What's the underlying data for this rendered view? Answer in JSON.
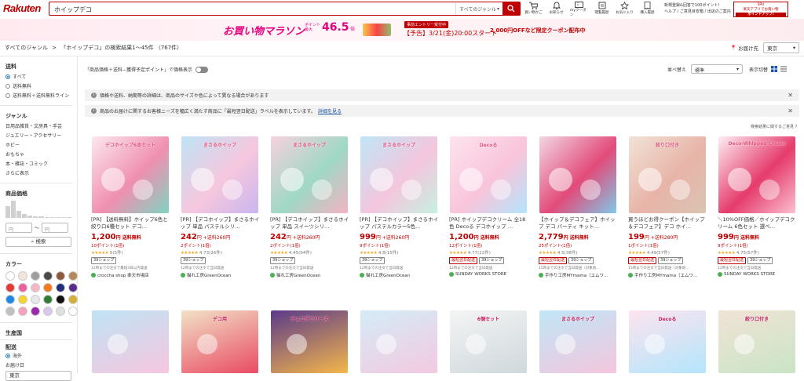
{
  "header": {
    "logo": "Rakuten",
    "search_value": "ホイップデコ",
    "genre_select": "すべてのジャンル",
    "icons": [
      {
        "label": "買い物かご",
        "icon": "cart-icon"
      },
      {
        "label": "お知らせ",
        "icon": "bell-icon"
      },
      {
        "label": "myクーポン",
        "icon": "coupon-icon"
      },
      {
        "label": "閲覧履歴",
        "icon": "history-icon"
      },
      {
        "label": "お気に入り",
        "icon": "star-icon"
      },
      {
        "label": "購入履歴",
        "icon": "receipt-icon"
      }
    ],
    "links_line1": "新規登録&回答で100ポイント!",
    "links_line2": "ヘルプ / ご意見目安箱 / 出店のご案内",
    "side_banner_top": "SPU",
    "side_banner_mid": "楽天アプリでお買い物",
    "side_banner_bottom": "ポイントアップ!"
  },
  "promo": {
    "title": "お買い物マラソン",
    "points_label": "ポイント最大",
    "points_value": "46.5",
    "points_suffix": "倍",
    "entry_label": "事前エントリー受付中",
    "date_text": "【予告】3/21(金)20:00スタート",
    "coupon_text": "2,000円OFFなど限定クーポン配布中"
  },
  "breadcrumb": {
    "root": "すべてのジャンル",
    "sep": ">",
    "current": "「ホイップデコ」の検索結果1～45件 （767件）"
  },
  "shipping": {
    "label": "お届け先",
    "value": "東京"
  },
  "sidebar": {
    "shipping_title": "送料",
    "shipping_options": [
      "すべて",
      "送料無料",
      "送料無料＋送料無料ライン"
    ],
    "genre_title": "ジャンル",
    "genres": [
      "日用品雑貨・文房具・手芸",
      "ジュエリー・アクセサリー",
      "ホビー",
      "おもちゃ",
      "本・雑誌・コミック",
      "さらに表示"
    ],
    "price_title": "商品価格",
    "price_min": "円",
    "price_tilde": "～",
    "price_max": "円",
    "price_button": "検索",
    "color_title": "カラー",
    "colors": [
      "#ffffff",
      "#f2e6d8",
      "#9e9e9e",
      "#4a4a4a",
      "#8a5a3c",
      "#b5895b",
      "#e53935",
      "#ec5f9b",
      "#f4b7c7",
      "#f07a1c",
      "#1f2d7a",
      "#5a2b8c",
      "#1e88e5",
      "#f6d32d",
      "#e8e8e8",
      "#2e7d32",
      "#111111",
      "#d4af37",
      "#c0c0c0",
      "#f6a0c0",
      "#9c27b0",
      "#d9c7f0",
      "#e0e0e0",
      "#ffffff"
    ],
    "origin_title": "生産国",
    "delivery_title": "配送",
    "delivery_option": "海外",
    "delivery_date_title": "お届け日",
    "delivery_place": "東京"
  },
  "main": {
    "price_toggle_label": "「商品価格＋送料−獲得予定ポイント」で価格表示",
    "sort_label": "並べ替え",
    "sort_value": "標準",
    "view_label": "表示切替",
    "notice1": "価格や送料、納期等の詳細は、商品のサイズや色によって異なる場合があります",
    "notice2": "商品のお届けに関するお客様ニーズを幅広く満たす商品に「最短翌日配送」ラベルを表示しています。",
    "notice2_link": "詳細を見る",
    "feedback": "検索結果に関するご意見"
  },
  "products": [
    {
      "title": "[PR] 【送料無料】ホイップ6色と絞り口6種セット デコ…",
      "price": "1,200",
      "ship": "円 送料無料",
      "points": "10ポイント(1倍)",
      "stars": "★★★★★",
      "rating": "5",
      "reviews": "(5件)",
      "tags": [
        "39ショップ"
      ],
      "delivery": "12時までの注文で最短3日以内発送",
      "shop": "croccha shop 楽天市場店",
      "img_text": "デコホイップ6本セット",
      "colors": [
        "#fbe9ee",
        "#f08fb0",
        "#7fd4c1"
      ]
    },
    {
      "title": "[PR] 【デコホイップ】まさるホイップ 単品 パステルシリ…",
      "price": "242",
      "ship": "円 +送料260円",
      "points": "2ポイント(1倍)",
      "stars": "★★★★★",
      "rating": "4.73",
      "reviews": "(26件)",
      "tags": [
        "39ショップ"
      ],
      "delivery": "12時までの注文で当日発送",
      "shop": "猫れ工房GreenOcean",
      "img_text": "まさるホイップ",
      "colors": [
        "#bfe3f5",
        "#f6c7de",
        "#c9b6ef"
      ]
    },
    {
      "title": "[PR] 【デコホイップ】まさるホイップ 単品 スイーツシリ…",
      "price": "242",
      "ship": "円 +送料260円",
      "points": "2ポイント(1倍)",
      "stars": "★★★★★",
      "rating": "4.45",
      "reviews": "(94件)",
      "tags": [
        "39ショップ"
      ],
      "delivery": "12時までの注文で当日発送",
      "shop": "猫れ工房GreenOcean",
      "img_text": "まさるホイップ",
      "colors": [
        "#f7d1dd",
        "#9fd8c6",
        "#f3b3c2"
      ]
    },
    {
      "title": "[PR] 【デコホイップ】まさるホイップ パステルカラー5色…",
      "price": "999",
      "ship": "円 +送料260円",
      "points": "9ポイント(1倍)",
      "stars": "★★★★★",
      "rating": "4.8",
      "reviews": "(15件)",
      "tags": [
        "39ショップ"
      ],
      "delivery": "12時までの注文で当日発送",
      "shop": "猫れ工房GreenOcean",
      "img_text": "まさるホイップ",
      "colors": [
        "#bfe6f7",
        "#f4c6dd",
        "#c7f0e0"
      ]
    },
    {
      "title": "[PR] ホイップデコクリーム 全18色 Decoる デコホイップ …",
      "price": "1,200",
      "ship": "円 送料無料",
      "points": "12ポイント(1倍)",
      "stars": "★★★★★",
      "rating": "4.77",
      "reviews": "(22件)",
      "tags": [
        "最短翌日配送",
        "39ショップ"
      ],
      "delivery": "12時までの注文で当日発送",
      "shop": "SUNDAY WORKS STORE",
      "img_text": "Decoる",
      "colors": [
        "#fde4ef",
        "#f9c4da",
        "#b3e5fc"
      ]
    },
    {
      "title": "【ホイップ＆デコフェア】ホイップ デコ パーティ キット…",
      "price": "2,779",
      "ship": "円 送料無料",
      "points": "25ポイント(1倍)",
      "stars": "★★★★★",
      "rating": "4.5",
      "reviews": "(38件)",
      "tags": [
        "最短翌日配送",
        "39ショップ"
      ],
      "delivery": "15時までの注文で当日発送（対象地…",
      "shop": "手作り工房MYmama（エムワ…",
      "img_text": "",
      "colors": [
        "#f3d6e4",
        "#e24b7a",
        "#7fc9e8"
      ]
    },
    {
      "title": "買うほどお得クーポン【ホイップ＆デコフェア】デコ ホイ…",
      "price": "199",
      "ship": "円 +送料280円",
      "points": "1ポイント(1倍)",
      "stars": "★★★★★",
      "rating": "4.49",
      "reviews": "(57件)",
      "tags": [
        "最短翌日配送",
        "39ショップ"
      ],
      "delivery": "15時までの注文で当日発送（対象地…",
      "shop": "手作り工房MYmama（エムワ…",
      "img_text": "絞り口付き",
      "colors": [
        "#f1e3d6",
        "#e8b4a8",
        "#d9c4b3"
      ]
    },
    {
      "title": "＼10%OFF価格／ホイップデコクリーム 6色セット 選べ…",
      "price": "999",
      "ship": "円 送料無料",
      "points": "9ポイント(1倍)",
      "stars": "★★★★★",
      "rating": "4.75",
      "reviews": "(57件)",
      "tags": [
        "最短翌日配送",
        "39ショップ"
      ],
      "delivery": "12時までの注文で当日発送",
      "shop": "SUNDAY WORKS STORE",
      "img_text": "Deco-Whipped Cream",
      "colors": [
        "#fdeef3",
        "#e53b6b",
        "#fbc1d2"
      ]
    }
  ],
  "products_row2": [
    {
      "label": "",
      "colors": [
        "#bfe3f5",
        "#f6c7de"
      ]
    },
    {
      "label": "デコ用",
      "colors": [
        "#f2e1c6",
        "#e94b64"
      ]
    },
    {
      "label": "チョコデコリーズ",
      "colors": [
        "#5b3a8a",
        "#f4b64a"
      ]
    },
    {
      "label": "",
      "colors": [
        "#d4ecf7",
        "#f3c9e0"
      ]
    },
    {
      "label": "6個セット",
      "colors": [
        "#f4f4f4",
        "#cfd8dc"
      ]
    },
    {
      "label": "まさるホイップ",
      "colors": [
        "#bfe6f7",
        "#f4c6dd"
      ]
    },
    {
      "label": "Decoる",
      "colors": [
        "#fde4ef",
        "#b3e5fc"
      ]
    },
    {
      "label": "絞り口付き",
      "colors": [
        "#f1e3d6",
        "#c9e4c5"
      ]
    }
  ]
}
